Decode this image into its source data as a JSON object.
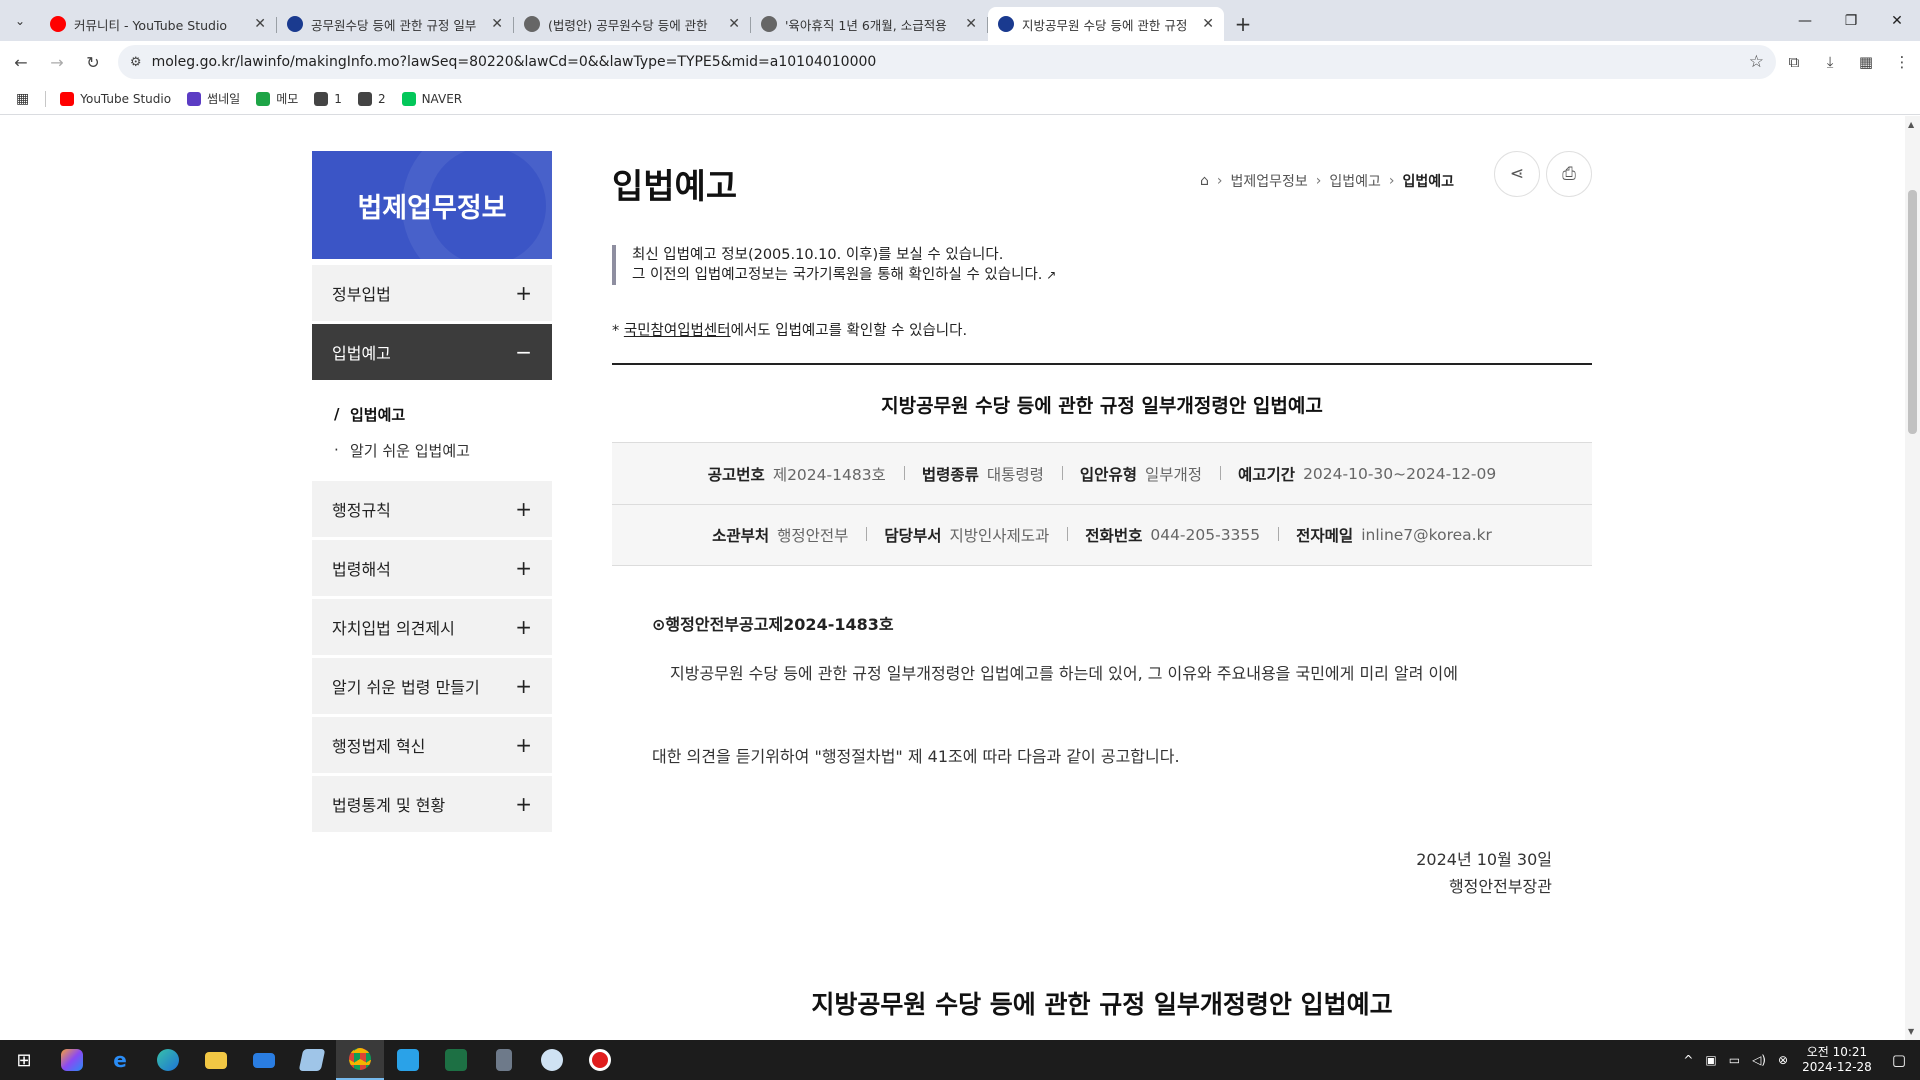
{
  "browser": {
    "tabs": [
      {
        "title": "커뮤니티 - YouTube Studio",
        "color": "#ff0000",
        "active": false
      },
      {
        "title": "공무원수당 등에 관한 규정 일부",
        "color": "#1a3a8f",
        "active": false
      },
      {
        "title": "(법령안) 공무원수당 등에 관한",
        "color": "#666666",
        "active": false
      },
      {
        "title": "'육아휴직 1년 6개월, 소급적용",
        "color": "#666666",
        "active": false
      },
      {
        "title": "지방공무원 수당 등에 관한 규정",
        "color": "#1a3a8f",
        "active": true
      }
    ],
    "url": "moleg.go.kr/lawinfo/makingInfo.mo?lawSeq=80220&lawCd=0&&lawType=TYPE5&mid=a10104010000",
    "bookmarks": [
      {
        "label": "YouTube Studio",
        "color": "#ff0000"
      },
      {
        "label": "썸네일",
        "color": "#5b3cc4"
      },
      {
        "label": "메모",
        "color": "#1ea446"
      },
      {
        "label": "1",
        "color": "#444444"
      },
      {
        "label": "2",
        "color": "#444444"
      },
      {
        "label": "NAVER",
        "color": "#03c75a"
      }
    ]
  },
  "sidebar": {
    "title": "법제업무정보",
    "items_before": [
      {
        "label": "정부입법",
        "sign": "+"
      }
    ],
    "open_item": {
      "label": "입법예고",
      "sign": "−"
    },
    "sub_items": [
      {
        "label": "입법예고",
        "current": true
      },
      {
        "label": "알기 쉬운 입법예고",
        "current": false
      }
    ],
    "items_after": [
      {
        "label": "행정규칙",
        "sign": "+"
      },
      {
        "label": "법령해석",
        "sign": "+"
      },
      {
        "label": "자치입법 의견제시",
        "sign": "+"
      },
      {
        "label": "알기 쉬운 법령 만들기",
        "sign": "+"
      },
      {
        "label": "행정법제 혁신",
        "sign": "+"
      },
      {
        "label": "법령통계 및 현황",
        "sign": "+"
      }
    ]
  },
  "content": {
    "page_title": "입법예고",
    "breadcrumb": [
      "법제업무정보",
      "입법예고",
      "입법예고"
    ],
    "note_line1": "최신 입법예고 정보(2005.10.10. 이후)를 보실 수 있습니다.",
    "note_line2": "그 이전의 입법예고정보는 국가기록원을 통해 확인하실 수 있습니다.",
    "note2_prefix": "* ",
    "note2_link": "국민참여입법센터",
    "note2_suffix": "에서도 입법예고를 확인할 수 있습니다.",
    "doc_title": "지방공무원 수당 등에 관한 규정 일부개정령안 입법예고",
    "info_row1": [
      {
        "k": "공고번호",
        "v": "제2024-1483호"
      },
      {
        "k": "법령종류",
        "v": "대통령령"
      },
      {
        "k": "입안유형",
        "v": "일부개정"
      },
      {
        "k": "예고기간",
        "v": "2024-10-30~2024-12-09"
      }
    ],
    "info_row2": [
      {
        "k": "소관부처",
        "v": "행정안전부"
      },
      {
        "k": "담당부서",
        "v": "지방인사제도과"
      },
      {
        "k": "전화번호",
        "v": "044-205-3355"
      },
      {
        "k": "전자메일",
        "v": "inline7@korea.kr"
      }
    ],
    "notice_no": "⊙행정안전부공고제2024-1483호",
    "para1": "지방공무원 수당 등에 관한 규정 일부개정령안 입법예고를 하는데 있어, 그 이유와 주요내용을 국민에게 미리 알려 이에",
    "para2": "대한 의견을 듣기위하여 \"행정절차법\" 제 41조에 따라 다음과 같이 공고합니다.",
    "date": "2024년 10월 30일",
    "signer": "행정안전부장관",
    "doc_title2": "지방공무원 수당 등에 관한 규정 일부개정령안 입법예고"
  },
  "taskbar": {
    "time": "오전 10:21",
    "date": "2024-12-28"
  }
}
